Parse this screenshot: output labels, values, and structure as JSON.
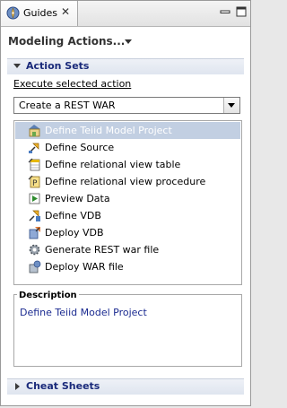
{
  "tab": {
    "label": "Guides",
    "close": "✕"
  },
  "header": {
    "title": "Modeling Actions..."
  },
  "action_sets": {
    "title": "Action Sets",
    "execute_label": "Execute selected action",
    "selected_set": "Create a REST WAR",
    "items": [
      {
        "label": "Define Teiid Model Project",
        "icon": "model-project-icon",
        "selected": true
      },
      {
        "label": "Define Source",
        "icon": "source-icon"
      },
      {
        "label": "Define relational view table",
        "icon": "view-table-icon"
      },
      {
        "label": "Define relational view procedure",
        "icon": "view-procedure-icon"
      },
      {
        "label": "Preview Data",
        "icon": "preview-data-icon"
      },
      {
        "label": "Define VDB",
        "icon": "vdb-icon"
      },
      {
        "label": "Deploy VDB",
        "icon": "deploy-vdb-icon"
      },
      {
        "label": "Generate REST war file",
        "icon": "gear-icon"
      },
      {
        "label": "Deploy WAR file",
        "icon": "deploy-war-icon"
      }
    ]
  },
  "description": {
    "title": "Description",
    "text": "Define Teiid Model Project"
  },
  "cheat_sheets": {
    "title": "Cheat Sheets"
  },
  "colors": {
    "section_title": "#1a2a7a",
    "selection": "#c2cfe2",
    "description_text": "#1a2a90"
  }
}
